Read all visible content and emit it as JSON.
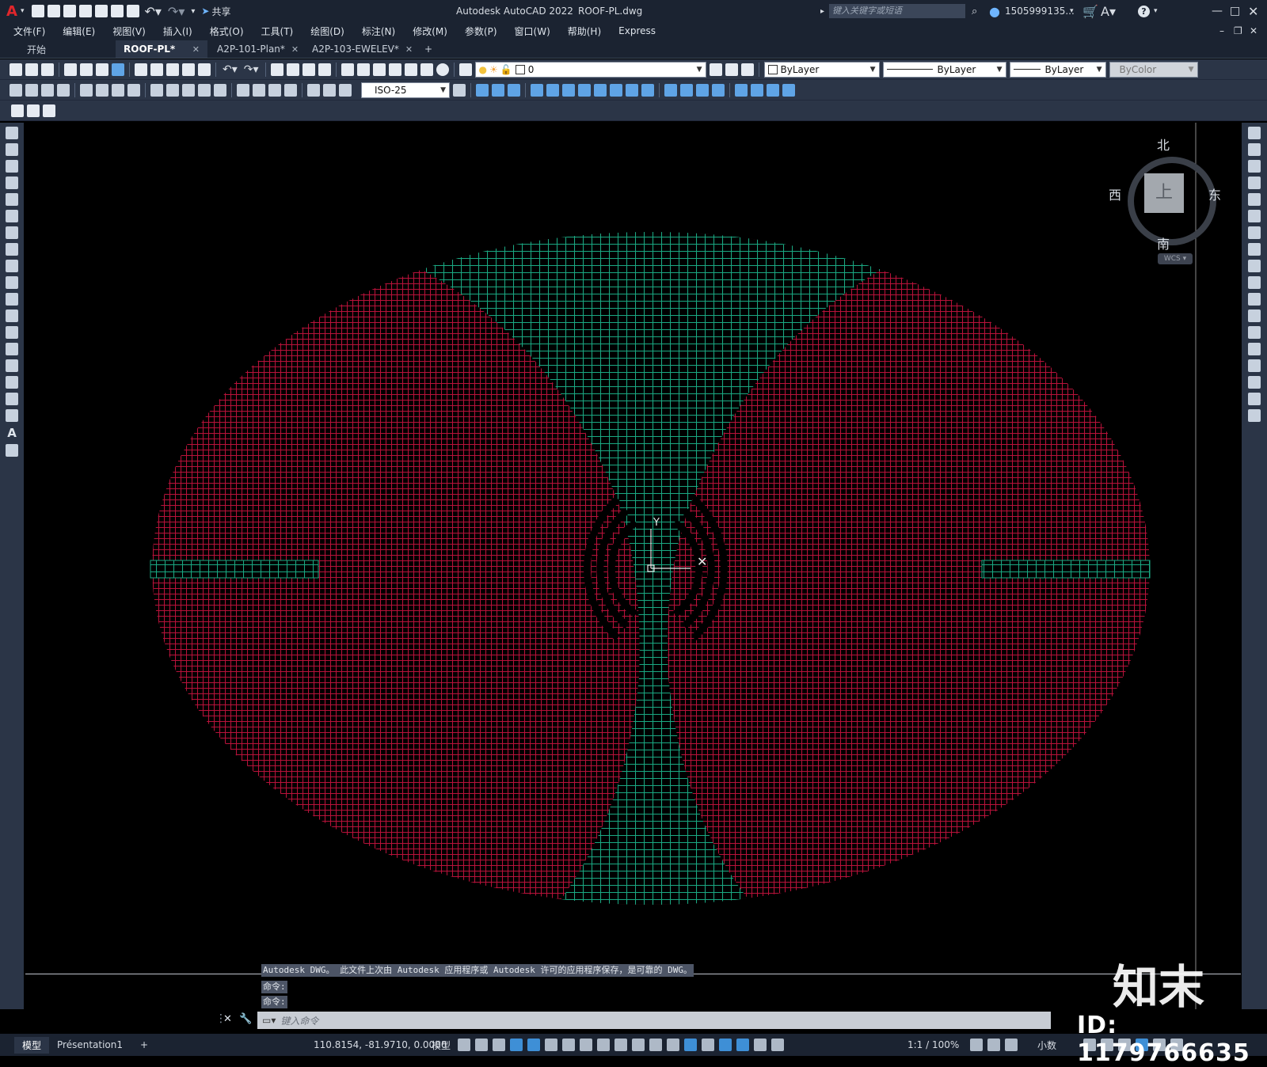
{
  "titlebar": {
    "app_logo": "A",
    "share_label": "共享",
    "app_title": "Autodesk AutoCAD 2022",
    "file_name": "ROOF-PL.dwg",
    "search_placeholder": "键入关键字或短语",
    "user": "1505999135...",
    "icons": [
      "new-icon",
      "open-icon",
      "save-icon",
      "saveas-icon",
      "plot-icon",
      "undo-icon",
      "redo-icon",
      "share-icon",
      "search-icon",
      "user-icon",
      "cart-icon",
      "help-icon",
      "minimize-icon",
      "maximize-icon",
      "close-icon"
    ]
  },
  "menu": [
    "文件(F)",
    "编辑(E)",
    "视图(V)",
    "插入(I)",
    "格式(O)",
    "工具(T)",
    "绘图(D)",
    "标注(N)",
    "修改(M)",
    "参数(P)",
    "窗口(W)",
    "帮助(H)",
    "Express"
  ],
  "tabs": [
    {
      "label": "开始",
      "active": false,
      "closable": false
    },
    {
      "label": "ROOF-PL*",
      "active": true,
      "closable": true
    },
    {
      "label": "A2P-101-Plan*",
      "active": false,
      "closable": true
    },
    {
      "label": "A2P-103-EWELEV*",
      "active": false,
      "closable": true
    }
  ],
  "properties": {
    "layer_value": "0",
    "color_value": "ByLayer",
    "linetype_value": "ByLayer",
    "lineweight_value": "ByLayer",
    "plotstyle_value": "ByColor",
    "dimstyle_value": "ISO-25"
  },
  "viewcube": {
    "north": "北",
    "south": "南",
    "east": "东",
    "west": "西",
    "face": "上",
    "wcs": "WCS"
  },
  "ucs": {
    "y_label": "Y"
  },
  "colors": {
    "roof_red": "#c0143c",
    "glass_green": "#1aa882",
    "ui_dark": "#1b2331",
    "ui_mid": "#2b3547"
  },
  "command": {
    "history": [
      "Autodesk DWG。 此文件上次由 Autodesk 应用程序或 Autodesk 许可的应用程序保存，是可靠的 DWG。",
      "命令:",
      "命令:"
    ],
    "input_placeholder": "键入命令"
  },
  "status": {
    "layout_tabs": [
      "模型",
      "Présentation1"
    ],
    "coordinates": "110.8154, -81.9710, 0.0000",
    "model_label": "模型",
    "scale": "1:1 / 100%",
    "units": "小数"
  },
  "watermark": {
    "brand": "知末",
    "id_text": "ID: 1179766635"
  }
}
